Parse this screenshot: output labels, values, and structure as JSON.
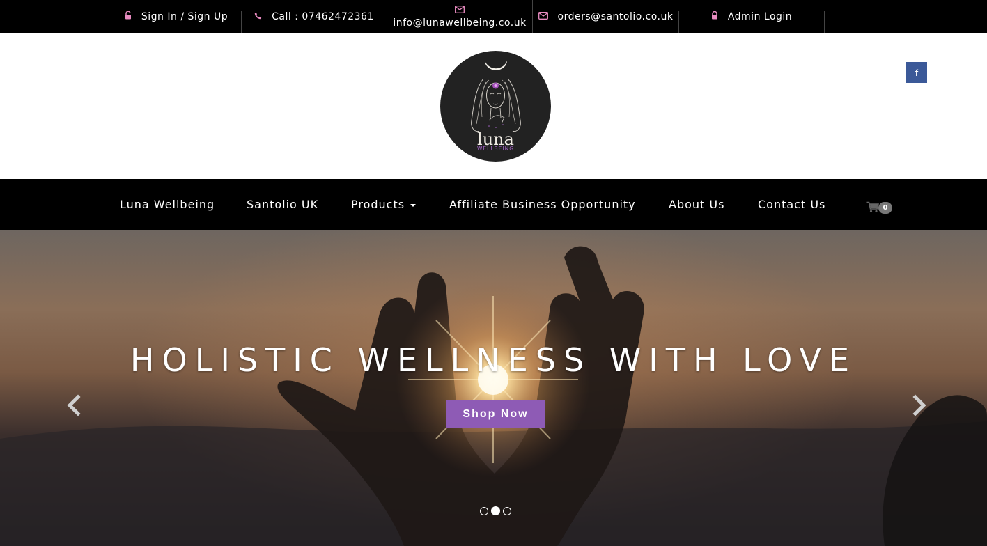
{
  "topbar": {
    "sign_in": "Sign In / Sign Up",
    "phone": "Call : 07462472361",
    "email1": "info@lunawellbeing.co.uk",
    "email2": "orders@santolio.co.uk",
    "admin": "Admin Login",
    "icon_color": "#e88bc0"
  },
  "logo": {
    "name": "luna",
    "sub": "WELLBEING"
  },
  "social": {
    "facebook": "f"
  },
  "nav": {
    "items": [
      "Luna Wellbeing",
      "Santolio UK",
      "Products",
      "Affiliate Business Opportunity",
      "About Us",
      "Contact Us"
    ],
    "cart_count": "0"
  },
  "hero": {
    "title": "HOLISTIC WELLNESS WITH LOVE",
    "button": "Shop Now",
    "button_color": "#8e5bb5",
    "slides": 3,
    "active_slide": 2
  }
}
